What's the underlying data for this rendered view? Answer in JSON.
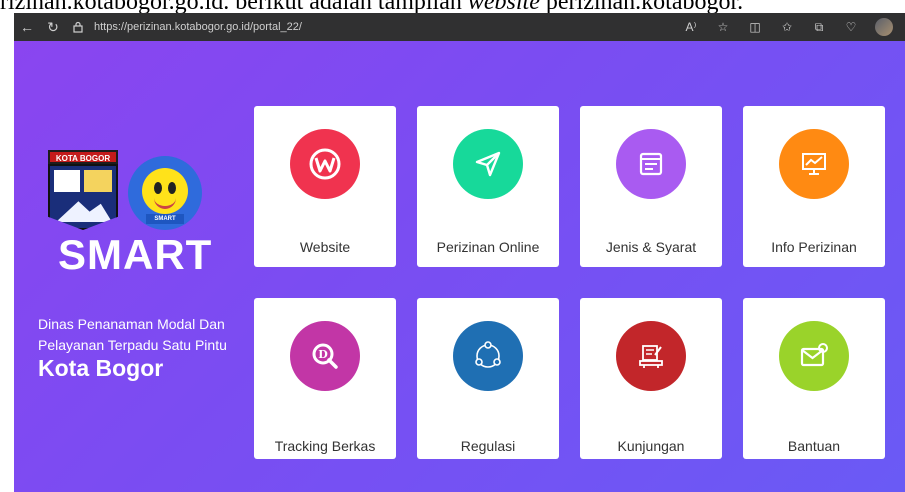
{
  "caption": {
    "part1": "rizinan.kotabogor.go.id.",
    "part2": " berikut adalah tampilan ",
    "part3": "website",
    "part4": " perizinan.kotabogor."
  },
  "browser": {
    "url": "https://perizinan.kotabogor.go.id/portal_22/"
  },
  "logo": {
    "kota_bogor_label": "KOTA BOGOR",
    "smart_ribbon": "SMART"
  },
  "brand": {
    "name": "SMART",
    "dinas_line1": "Dinas Penanaman Modal Dan",
    "dinas_line2": "Pelayanan Terpadu Satu Pintu",
    "city": "Kota Bogor"
  },
  "tiles": [
    {
      "label": "Website",
      "color": "#f0334f",
      "icon": "website-w-icon"
    },
    {
      "label": "Perizinan Online",
      "color": "#17d99a",
      "icon": "send-icon"
    },
    {
      "label": "Jenis & Syarat",
      "color": "#a95bf1",
      "icon": "window-list-icon"
    },
    {
      "label": "Info Perizinan",
      "color": "#ff8a12",
      "icon": "monitor-chart-icon"
    },
    {
      "label": "Tracking Berkas",
      "color": "#c236a6",
      "icon": "search-d-icon"
    },
    {
      "label": "Regulasi",
      "color": "#1f6fb3",
      "icon": "cycle-icon"
    },
    {
      "label": "Kunjungan",
      "color": "#c2262a",
      "icon": "desk-icon"
    },
    {
      "label": "Bantuan",
      "color": "#9ad32a",
      "icon": "mail-icon"
    }
  ]
}
